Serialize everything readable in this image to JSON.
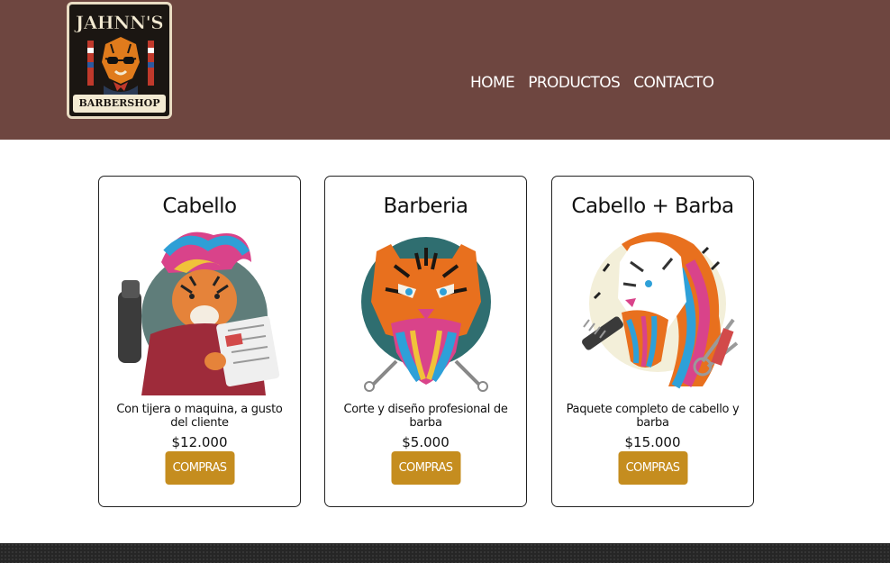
{
  "header": {
    "logo": {
      "line1": "JAHNN'S",
      "line2": "BARBERSHOP",
      "icon": "tiger-logo-icon"
    },
    "nav": [
      {
        "label": "HOME"
      },
      {
        "label": "PRODUCTOS"
      },
      {
        "label": "CONTACTO"
      }
    ]
  },
  "colors": {
    "header_bg": "#6e4640",
    "button_bg": "#c58d1f",
    "footer_bg": "#262626"
  },
  "products": [
    {
      "title": "Cabello",
      "description": "Con tijera o maquina, a gusto del cliente",
      "price": "$12.000",
      "button": "COMPRAS",
      "image": "tiger-haircut-illustration"
    },
    {
      "title": "Barberia",
      "description": "Corte y diseño profesional de barba",
      "price": "$5.000",
      "button": "COMPRAS",
      "image": "tiger-beard-illustration"
    },
    {
      "title": "Cabello + Barba",
      "description": "Paquete completo de cabello y barba",
      "price": "$15.000",
      "button": "COMPRAS",
      "image": "white-tiger-illustration"
    }
  ]
}
